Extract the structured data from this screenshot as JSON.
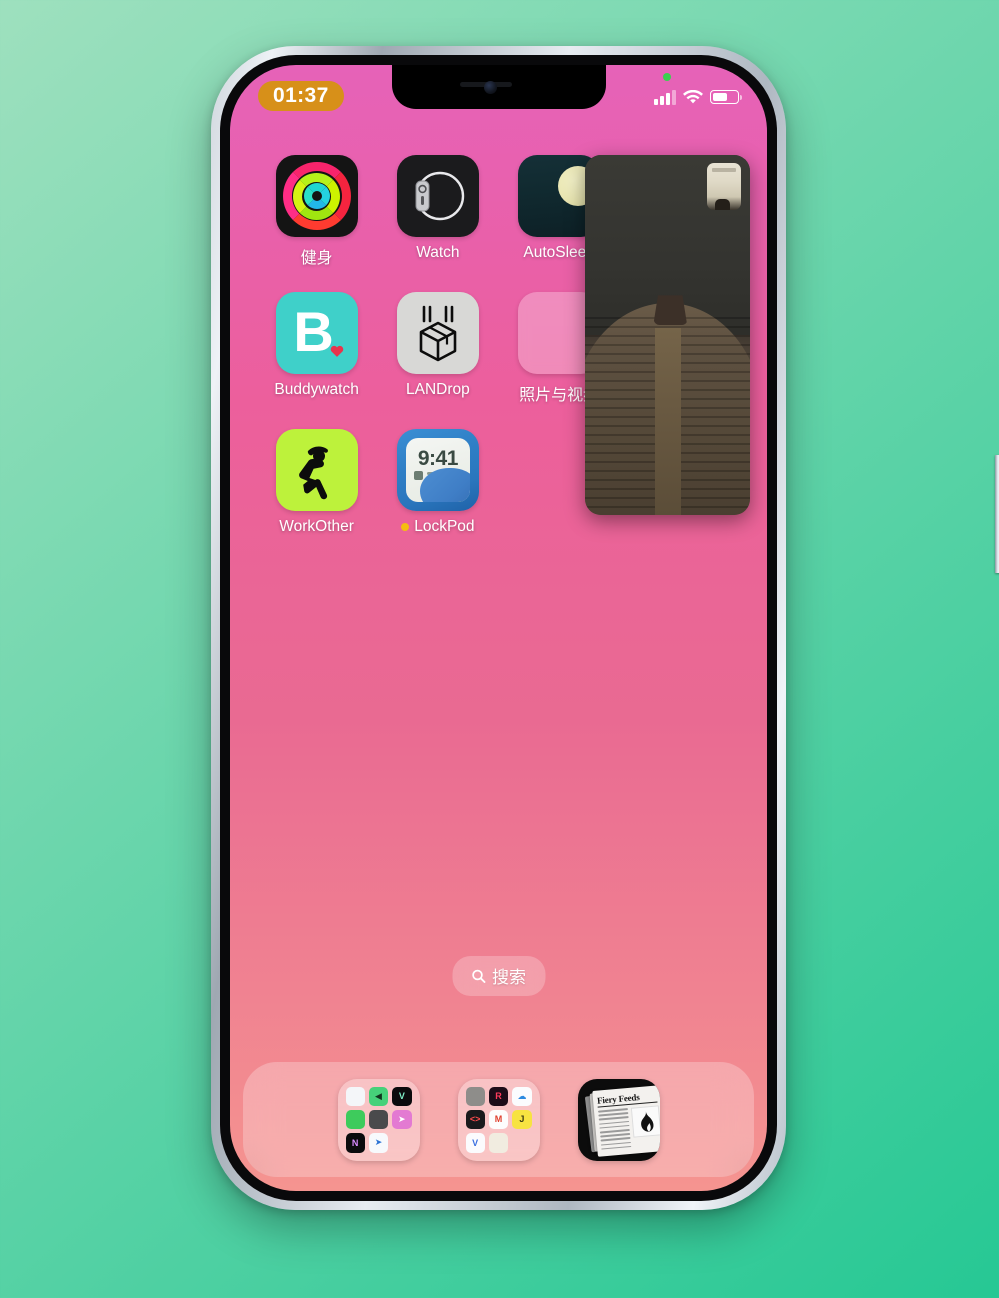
{
  "device": {
    "name": "iPhone",
    "frame_color": "#cfd6dd",
    "bezel_color": "#09090b"
  },
  "background": {
    "color_top": "#9ee0be",
    "color_bottom": "#26c894"
  },
  "wallpaper": {
    "color_top": "#e662b8",
    "color_bottom": "#f59490"
  },
  "status_bar": {
    "time": "01:37",
    "time_pill_color": "#d79019",
    "privacy_indicator": "green-dot",
    "cellular": "cellular-icon",
    "wifi": "wifi-icon",
    "battery": "battery-icon",
    "battery_level": 62
  },
  "home_screen": {
    "apps": [
      {
        "id": "fitness",
        "label": "健身",
        "icon": "fitness-rings-icon"
      },
      {
        "id": "watch",
        "label": "Watch",
        "icon": "apple-watch-icon"
      },
      {
        "id": "autosleep",
        "label": "AutoSleep",
        "icon": "moon-night-icon"
      },
      {
        "id": "buddywatch",
        "label": "Buddywatch",
        "icon": "letter-b-heart-icon"
      },
      {
        "id": "landrop",
        "label": "LANDrop",
        "icon": "dropping-box-icon"
      },
      {
        "id": "photosfolder",
        "label": "照片与视频",
        "icon": "folder-icon"
      },
      {
        "id": "workother",
        "label": "WorkOther",
        "icon": "stretching-person-icon"
      },
      {
        "id": "lockpod",
        "label": "LockPod",
        "icon": "lockscreen-preview-icon",
        "badge_dot": true,
        "badge_dot_color": "#f5bd11",
        "preview_time": "9:41"
      }
    ],
    "photos_folder_minis": [
      {
        "name": "owl-app-icon",
        "bg": "#dfe7e8"
      },
      {
        "name": "grid-app-icon",
        "bg": "#232326"
      },
      {
        "name": "dark-app-icon",
        "bg": "#3a3a3c"
      },
      {
        "name": "halfmoon-app-icon",
        "bg": "#121214"
      },
      {
        "name": "starry-app-icon",
        "bg": "#1d2a5e"
      }
    ]
  },
  "search": {
    "label": "搜索",
    "icon": "search-icon"
  },
  "dock": {
    "items": [
      {
        "id": "folder-social",
        "type": "folder",
        "minis": [
          {
            "name": "pixel-blue-app-icon",
            "bg": "#f4f6f9",
            "glyph": "",
            "fg": "#2a6ff0"
          },
          {
            "name": "green-arrow-app-icon",
            "bg": "#46d17a",
            "glyph": "◀",
            "fg": "#11351f"
          },
          {
            "name": "letter-v-app-icon",
            "bg": "#0b0b0d",
            "glyph": "V",
            "fg": "#7ef0c8"
          },
          {
            "name": "wechat-app-icon",
            "bg": "#3ecb5c",
            "glyph": "",
            "fg": "#ffffff"
          },
          {
            "name": "gray-tool-app-icon",
            "bg": "#4a4a4c",
            "glyph": "",
            "fg": "#dcdcdc"
          },
          {
            "name": "telegram-app-icon",
            "bg": "#e37ad2",
            "glyph": "➤",
            "fg": "#ffffff"
          },
          {
            "name": "letter-n-app-icon",
            "bg": "#0b0b0d",
            "glyph": "N",
            "fg": "#d98bff"
          },
          {
            "name": "blue-bird-app-icon",
            "bg": "#f7f9fc",
            "glyph": "➤",
            "fg": "#2a72d4"
          }
        ]
      },
      {
        "id": "folder-utilities",
        "type": "folder",
        "minis": [
          {
            "name": "camera-app-icon",
            "bg": "#8e8d8a",
            "glyph": "",
            "fg": "#ffffff"
          },
          {
            "name": "letter-r-app-icon",
            "bg": "#1c0c18",
            "glyph": "R",
            "fg": "#ff3b5c"
          },
          {
            "name": "cloud-app-icon",
            "bg": "#fbfcfe",
            "glyph": "☁",
            "fg": "#2b8ae0"
          },
          {
            "name": "code-brackets-app-icon",
            "bg": "#1a1a1c",
            "glyph": "<>",
            "fg": "#ff4d4d"
          },
          {
            "name": "gmail-app-icon",
            "bg": "#fdfdfd",
            "glyph": "M",
            "fg": "#e0402e"
          },
          {
            "name": "letter-j-app-icon",
            "bg": "#f7e341",
            "glyph": "J",
            "fg": "#3b3a12"
          },
          {
            "name": "letter-v-blue-app-icon",
            "bg": "#fbfbfd",
            "glyph": "V",
            "fg": "#3a6fe0"
          },
          {
            "name": "beige-app-icon",
            "bg": "#f1ece0",
            "glyph": "",
            "fg": "#b8a88a"
          }
        ]
      },
      {
        "id": "fiery-feeds",
        "type": "app",
        "name": "fiery-feeds-icon",
        "masthead": "Fiery Feeds"
      }
    ]
  },
  "pip": {
    "name": "picture-in-picture-video",
    "description": "dark-camera-view"
  }
}
